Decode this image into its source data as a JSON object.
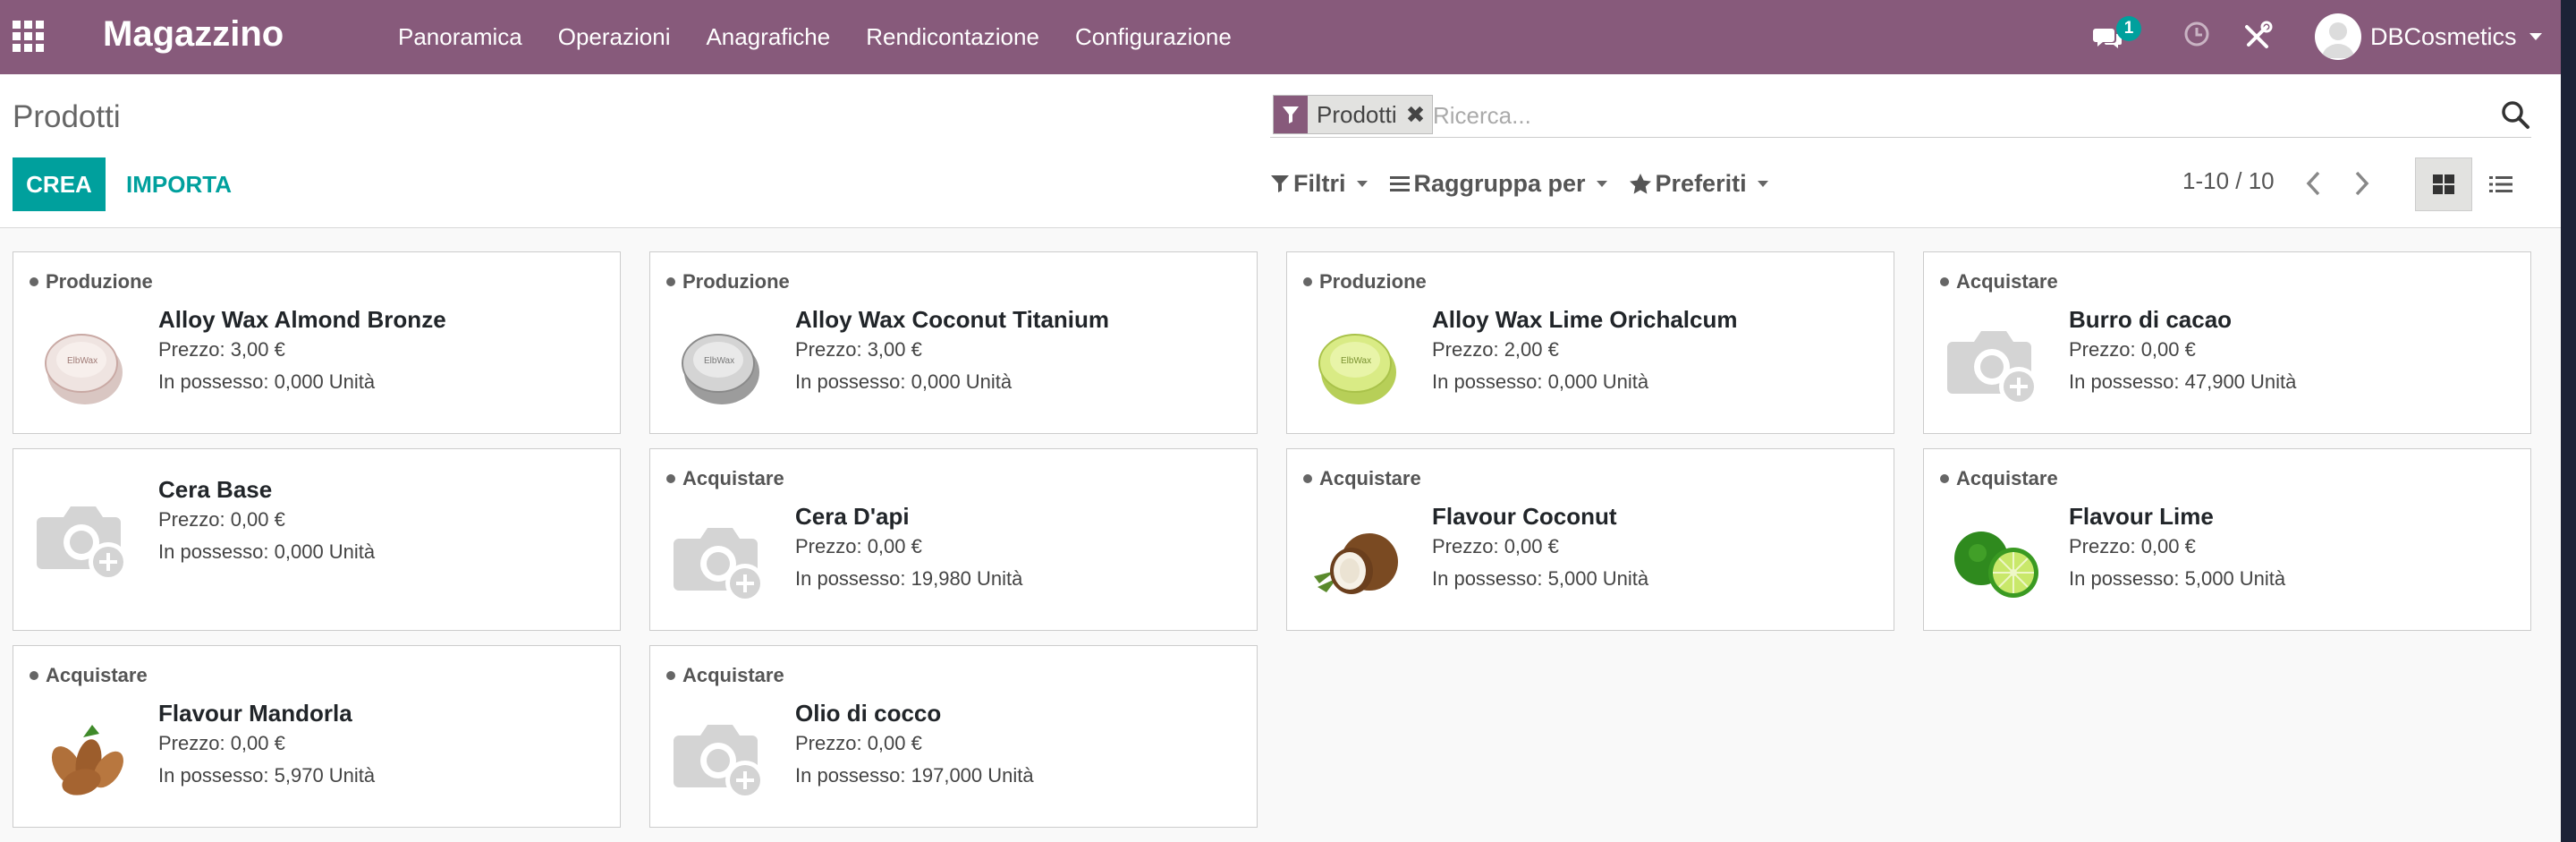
{
  "navbar": {
    "app_name": "Magazzino",
    "menu": [
      "Panoramica",
      "Operazioni",
      "Anagrafiche",
      "Rendicontazione",
      "Configurazione"
    ],
    "messages_count": "1",
    "user": "DBCosmetics",
    "color": "#875a7b"
  },
  "control_panel": {
    "breadcrumb": "Prodotti",
    "create_label": "CREA",
    "import_label": "IMPORTA",
    "search_facet": "Prodotti",
    "search_placeholder": "Ricerca...",
    "filters_label": "Filtri",
    "groupby_label": "Raggruppa per",
    "favorites_label": "Preferiti",
    "pager": "1-10 / 10",
    "accent": "#00a09d"
  },
  "products": [
    {
      "tag": "Produzione",
      "name": "Alloy Wax Almond Bronze",
      "price": "Prezzo: 3,00 €",
      "stock": "In possesso: 0,000 Unità",
      "image": "wax-tin-bronze"
    },
    {
      "tag": "Produzione",
      "name": "Alloy Wax Coconut Titanium",
      "price": "Prezzo: 3,00 €",
      "stock": "In possesso: 0,000 Unità",
      "image": "wax-tin-titanium"
    },
    {
      "tag": "Produzione",
      "name": "Alloy Wax Lime Orichalcum",
      "price": "Prezzo: 2,00 €",
      "stock": "In possesso: 0,000 Unità",
      "image": "wax-tin-lime"
    },
    {
      "tag": "Acquistare",
      "name": "Burro di cacao",
      "price": "Prezzo: 0,00 €",
      "stock": "In possesso: 47,900 Unità",
      "image": "camera-placeholder"
    },
    {
      "tag": "",
      "name": "Cera Base",
      "price": "Prezzo: 0,00 €",
      "stock": "In possesso: 0,000 Unità",
      "image": "camera-placeholder"
    },
    {
      "tag": "Acquistare",
      "name": "Cera D'api",
      "price": "Prezzo: 0,00 €",
      "stock": "In possesso: 19,980 Unità",
      "image": "camera-placeholder"
    },
    {
      "tag": "Acquistare",
      "name": "Flavour Coconut",
      "price": "Prezzo: 0,00 €",
      "stock": "In possesso: 5,000 Unità",
      "image": "coconut"
    },
    {
      "tag": "Acquistare",
      "name": "Flavour Lime",
      "price": "Prezzo: 0,00 €",
      "stock": "In possesso: 5,000 Unità",
      "image": "lime"
    },
    {
      "tag": "Acquistare",
      "name": "Flavour Mandorla",
      "price": "Prezzo: 0,00 €",
      "stock": "In possesso: 5,970 Unità",
      "image": "almonds"
    },
    {
      "tag": "Acquistare",
      "name": "Olio di cocco",
      "price": "Prezzo: 0,00 €",
      "stock": "In possesso: 197,000 Unità",
      "image": "camera-placeholder"
    }
  ]
}
